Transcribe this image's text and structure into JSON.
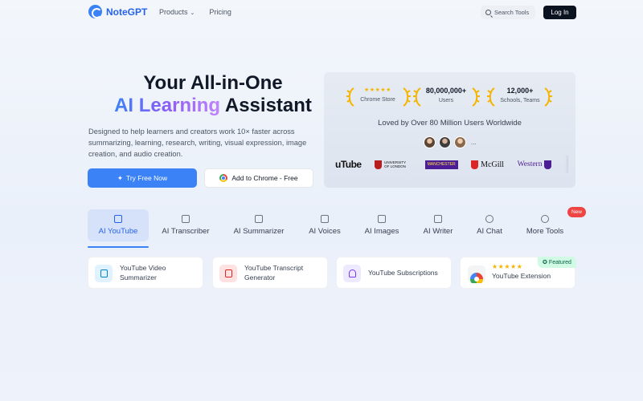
{
  "header": {
    "brand": "NoteGPT",
    "nav": [
      {
        "label": "Products",
        "has_dropdown": true
      },
      {
        "label": "Pricing",
        "has_dropdown": false
      }
    ],
    "search_label": "Search Tools",
    "login_label": "Log In"
  },
  "hero": {
    "title_line1": "Your All-in-One",
    "title_line2_gradient": "AI Learning",
    "title_line2_rest": " Assistant",
    "description": "Designed to help learners and creators work 10× faster across summarizing, learning, research, writing, visual expression, image creation, and audio creation.",
    "primary_button": "Try Free Now",
    "secondary_button": "Add to Chrome - Free"
  },
  "stats": {
    "items": [
      {
        "value": "★★★★★",
        "label": "Chrome Store"
      },
      {
        "value": "80,000,000+",
        "label": "Users"
      },
      {
        "value": "12,000+",
        "label": "Schools, Teams"
      }
    ],
    "tagline": "Loved by Over 80 Million Users Worldwide",
    "avatars_more": "...",
    "logos": [
      {
        "name": "youtube",
        "text": "uTube"
      },
      {
        "name": "university-of-london",
        "text": "UNIVERSITY OF LONDON"
      },
      {
        "name": "manchester",
        "text": "MANCHESTER"
      },
      {
        "name": "mcgill",
        "text": "McGill"
      },
      {
        "name": "western",
        "text": "Western"
      }
    ]
  },
  "tabs": [
    {
      "label": "AI YouTube",
      "icon": "play-icon",
      "active": true
    },
    {
      "label": "AI Transcriber",
      "icon": "cc-icon"
    },
    {
      "label": "AI Summarizer",
      "icon": "document-icon"
    },
    {
      "label": "AI Voices",
      "icon": "voice-icon"
    },
    {
      "label": "AI Images",
      "icon": "image-icon"
    },
    {
      "label": "AI Writer",
      "icon": "pen-icon"
    },
    {
      "label": "AI Chat",
      "icon": "chat-icon"
    },
    {
      "label": "More Tools",
      "icon": "more-icon",
      "badge": "New"
    }
  ],
  "tool_cards": [
    {
      "title": "YouTube Video Summarizer",
      "icon": "document-icon"
    },
    {
      "title": "YouTube Transcript Generator",
      "icon": "cc-icon"
    },
    {
      "title": "YouTube Subscriptions",
      "icon": "bell-icon"
    },
    {
      "title": "YouTube Extension",
      "icon": "chrome-icon",
      "badge": "Featured",
      "rating": "★★★★★"
    }
  ],
  "colors": {
    "accent": "#3b82f6",
    "login_bg": "#0b1220",
    "badge_new": "#ef4444",
    "featured_bg": "#d1fae5",
    "star": "#f5b400"
  }
}
